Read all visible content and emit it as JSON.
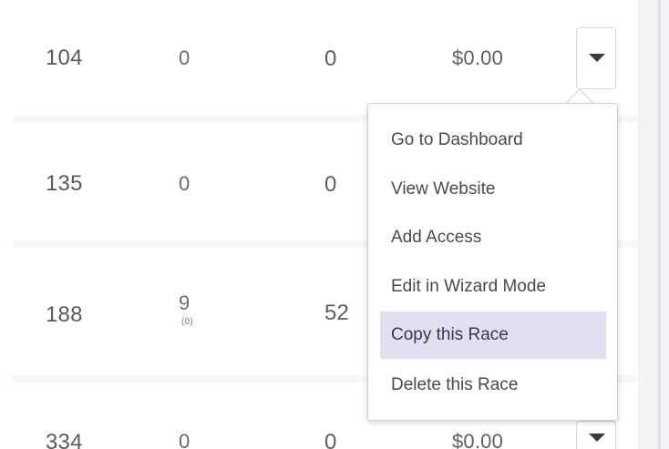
{
  "table": {
    "rows": [
      {
        "id": "104",
        "col_a": "0",
        "col_a_sub": "",
        "col_b": "0",
        "amount": "$0.00"
      },
      {
        "id": "135",
        "col_a": "0",
        "col_a_sub": "",
        "col_b": "0",
        "amount": ""
      },
      {
        "id": "188",
        "col_a": "9",
        "col_a_sub": "(0)",
        "col_b": "52",
        "amount": ""
      },
      {
        "id": "334",
        "col_a": "0",
        "col_a_sub": "",
        "col_b": "0",
        "amount": "$0.00"
      }
    ]
  },
  "dropdown": {
    "items": [
      {
        "label": "Go to Dashboard"
      },
      {
        "label": "View Website"
      },
      {
        "label": "Add Access"
      },
      {
        "label": "Edit in Wizard Mode"
      },
      {
        "label": "Copy this Race",
        "active": true
      },
      {
        "label": "Delete this Race"
      }
    ]
  },
  "icons": {
    "row_menu_toggle": "caret-down-icon"
  },
  "colors": {
    "menu_active_bg": "#e3dff0",
    "text": "#5b5b5b"
  }
}
